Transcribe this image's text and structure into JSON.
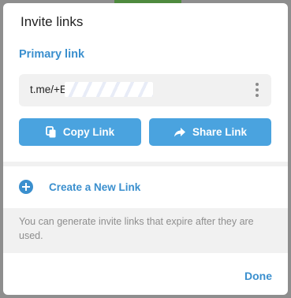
{
  "dialog": {
    "title": "Invite links",
    "primary_section_title": "Primary link",
    "link_value": "t.me/+E",
    "link_suffix": "_",
    "copy_button_label": "Copy Link",
    "share_button_label": "Share Link",
    "new_link_label": "Create a New Link",
    "info_text": "You can generate invite links that expire after they are used.",
    "done_label": "Done"
  },
  "icons": {
    "more": "more-vertical-icon",
    "copy": "copy-icon",
    "share": "share-arrow-icon",
    "add": "plus-circle-icon"
  },
  "colors": {
    "accent": "#3a8fce",
    "button": "#4aa3df",
    "field_background": "#f1f1f1",
    "muted_text": "#8e8e8e"
  }
}
